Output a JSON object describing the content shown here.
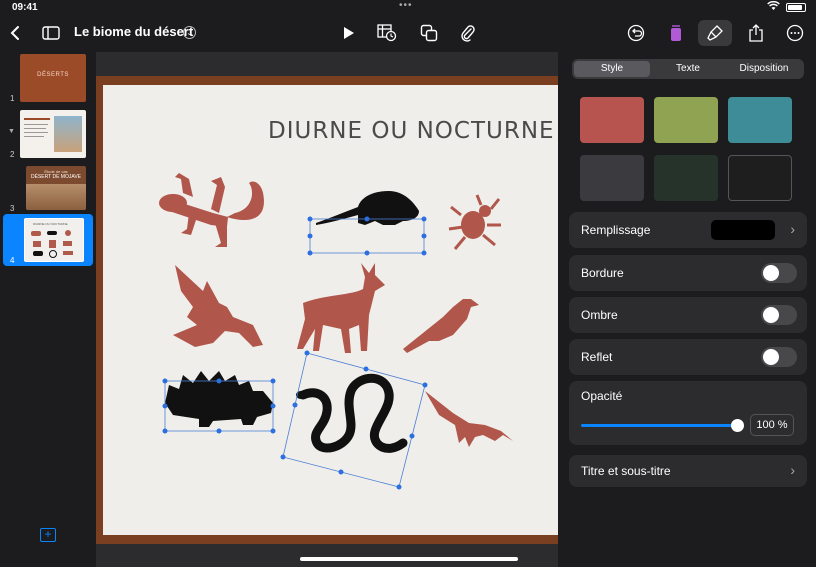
{
  "status_bar": {
    "time": "09:41"
  },
  "toolbar": {
    "doc_title": "Le biome du désert"
  },
  "slides": [
    {
      "number": "1",
      "title": "DÉSERTS"
    },
    {
      "number": "2",
      "title": ""
    },
    {
      "number": "3",
      "subtitle": "Étude de cas",
      "title": "DÉSERT DE MOJAVE"
    },
    {
      "number": "4",
      "title": "DIURNE OU NOCTURNE"
    }
  ],
  "slide": {
    "title": "DIURNE OU NOCTURNE"
  },
  "panel": {
    "tabs": [
      "Style",
      "Texte",
      "Disposition"
    ],
    "active_tab": "Style",
    "swatches": [
      "#b85450",
      "#8fa352",
      "#3d8c97",
      "#3a3a3f",
      "#26332a",
      "#1e1e1e"
    ],
    "fill_label": "Remplissage",
    "fill_color": "#000000",
    "border_label": "Bordure",
    "shadow_label": "Ombre",
    "reflection_label": "Reflet",
    "opacity_label": "Opacité",
    "opacity_value": "100 %",
    "title_subtitle_label": "Titre et sous-titre"
  }
}
